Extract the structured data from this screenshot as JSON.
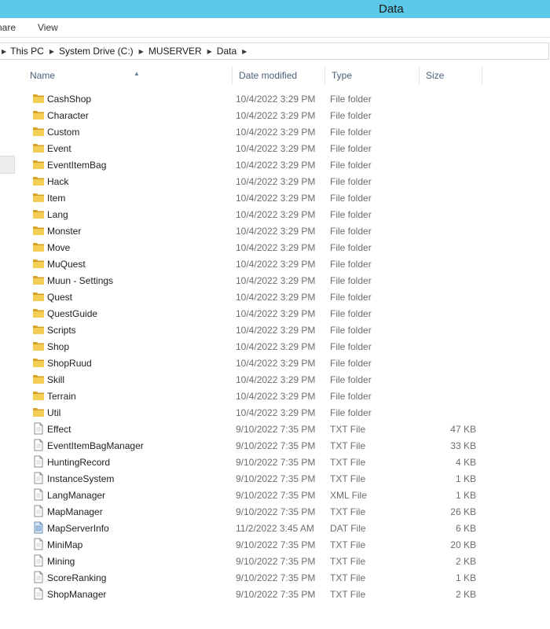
{
  "window": {
    "title": "Data"
  },
  "ribbon": {
    "tabs": [
      "nare",
      "View"
    ]
  },
  "address": {
    "crumbs": [
      "This PC",
      "System Drive (C:)",
      "MUSERVER",
      "Data"
    ]
  },
  "columns": {
    "name": "Name",
    "date": "Date modified",
    "type": "Type",
    "size": "Size"
  },
  "icons": {
    "folder": "folder-icon",
    "txt": "text-file-icon",
    "xml": "text-file-icon",
    "dat": "data-file-icon"
  },
  "colors": {
    "titlebar": "#5bc8e8",
    "header_text": "#4c607a",
    "folder": "#e8b838"
  },
  "files": [
    {
      "name": "CashShop",
      "date": "10/4/2022 3:29 PM",
      "type": "File folder",
      "size": "",
      "kind": "folder"
    },
    {
      "name": "Character",
      "date": "10/4/2022 3:29 PM",
      "type": "File folder",
      "size": "",
      "kind": "folder"
    },
    {
      "name": "Custom",
      "date": "10/4/2022 3:29 PM",
      "type": "File folder",
      "size": "",
      "kind": "folder"
    },
    {
      "name": "Event",
      "date": "10/4/2022 3:29 PM",
      "type": "File folder",
      "size": "",
      "kind": "folder"
    },
    {
      "name": "EventItemBag",
      "date": "10/4/2022 3:29 PM",
      "type": "File folder",
      "size": "",
      "kind": "folder"
    },
    {
      "name": "Hack",
      "date": "10/4/2022 3:29 PM",
      "type": "File folder",
      "size": "",
      "kind": "folder"
    },
    {
      "name": "Item",
      "date": "10/4/2022 3:29 PM",
      "type": "File folder",
      "size": "",
      "kind": "folder"
    },
    {
      "name": "Lang",
      "date": "10/4/2022 3:29 PM",
      "type": "File folder",
      "size": "",
      "kind": "folder"
    },
    {
      "name": "Monster",
      "date": "10/4/2022 3:29 PM",
      "type": "File folder",
      "size": "",
      "kind": "folder"
    },
    {
      "name": "Move",
      "date": "10/4/2022 3:29 PM",
      "type": "File folder",
      "size": "",
      "kind": "folder"
    },
    {
      "name": "MuQuest",
      "date": "10/4/2022 3:29 PM",
      "type": "File folder",
      "size": "",
      "kind": "folder"
    },
    {
      "name": "Muun - Settings",
      "date": "10/4/2022 3:29 PM",
      "type": "File folder",
      "size": "",
      "kind": "folder"
    },
    {
      "name": "Quest",
      "date": "10/4/2022 3:29 PM",
      "type": "File folder",
      "size": "",
      "kind": "folder"
    },
    {
      "name": "QuestGuide",
      "date": "10/4/2022 3:29 PM",
      "type": "File folder",
      "size": "",
      "kind": "folder"
    },
    {
      "name": "Scripts",
      "date": "10/4/2022 3:29 PM",
      "type": "File folder",
      "size": "",
      "kind": "folder"
    },
    {
      "name": "Shop",
      "date": "10/4/2022 3:29 PM",
      "type": "File folder",
      "size": "",
      "kind": "folder"
    },
    {
      "name": "ShopRuud",
      "date": "10/4/2022 3:29 PM",
      "type": "File folder",
      "size": "",
      "kind": "folder"
    },
    {
      "name": "Skill",
      "date": "10/4/2022 3:29 PM",
      "type": "File folder",
      "size": "",
      "kind": "folder"
    },
    {
      "name": "Terrain",
      "date": "10/4/2022 3:29 PM",
      "type": "File folder",
      "size": "",
      "kind": "folder"
    },
    {
      "name": "Util",
      "date": "10/4/2022 3:29 PM",
      "type": "File folder",
      "size": "",
      "kind": "folder"
    },
    {
      "name": "Effect",
      "date": "9/10/2022 7:35 PM",
      "type": "TXT File",
      "size": "47 KB",
      "kind": "txt"
    },
    {
      "name": "EventItemBagManager",
      "date": "9/10/2022 7:35 PM",
      "type": "TXT File",
      "size": "33 KB",
      "kind": "txt"
    },
    {
      "name": "HuntingRecord",
      "date": "9/10/2022 7:35 PM",
      "type": "TXT File",
      "size": "4 KB",
      "kind": "txt"
    },
    {
      "name": "InstanceSystem",
      "date": "9/10/2022 7:35 PM",
      "type": "TXT File",
      "size": "1 KB",
      "kind": "txt"
    },
    {
      "name": "LangManager",
      "date": "9/10/2022 7:35 PM",
      "type": "XML File",
      "size": "1 KB",
      "kind": "xml"
    },
    {
      "name": "MapManager",
      "date": "9/10/2022 7:35 PM",
      "type": "TXT File",
      "size": "26 KB",
      "kind": "txt"
    },
    {
      "name": "MapServerInfo",
      "date": "11/2/2022 3:45 AM",
      "type": "DAT File",
      "size": "6 KB",
      "kind": "dat"
    },
    {
      "name": "MiniMap",
      "date": "9/10/2022 7:35 PM",
      "type": "TXT File",
      "size": "20 KB",
      "kind": "txt"
    },
    {
      "name": "Mining",
      "date": "9/10/2022 7:35 PM",
      "type": "TXT File",
      "size": "2 KB",
      "kind": "txt"
    },
    {
      "name": "ScoreRanking",
      "date": "9/10/2022 7:35 PM",
      "type": "TXT File",
      "size": "1 KB",
      "kind": "txt"
    },
    {
      "name": "ShopManager",
      "date": "9/10/2022 7:35 PM",
      "type": "TXT File",
      "size": "2 KB",
      "kind": "txt"
    }
  ]
}
